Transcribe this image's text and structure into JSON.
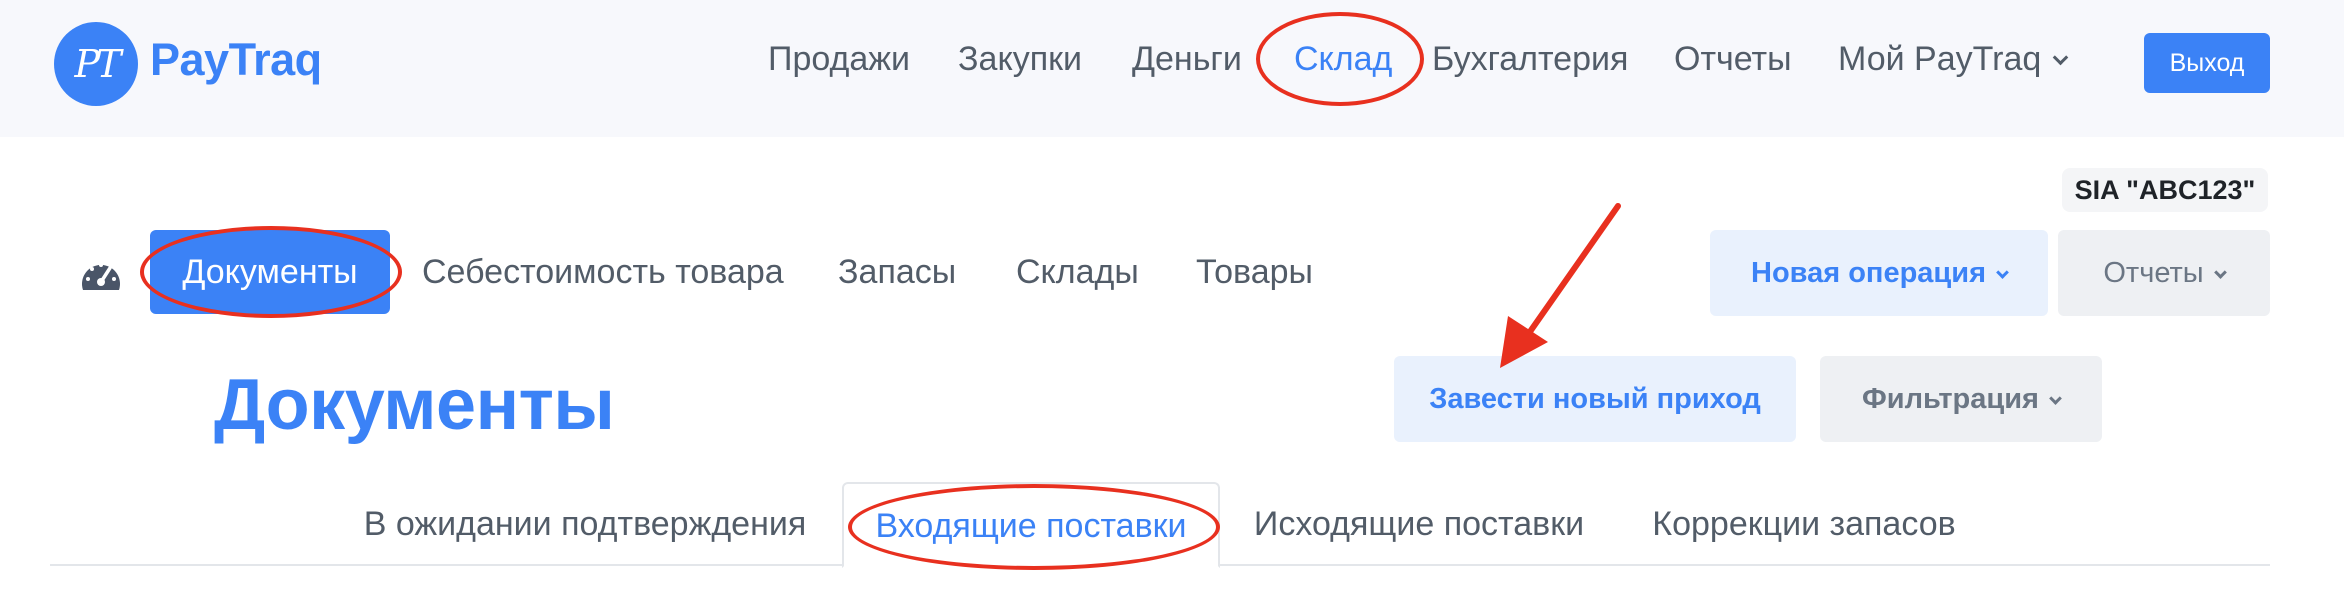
{
  "header": {
    "logo_letters": "PT",
    "brand": "PayTraq",
    "nav": [
      {
        "label": "Продажи"
      },
      {
        "label": "Закупки"
      },
      {
        "label": "Деньги"
      },
      {
        "label": "Склад",
        "active": true
      },
      {
        "label": "Бухгалтерия"
      },
      {
        "label": "Отчеты"
      },
      {
        "label": "Мой PayTraq"
      }
    ],
    "logout_label": "Выход"
  },
  "company": "SIA \"ABC123\"",
  "subnav": {
    "items": [
      {
        "label": "Документы",
        "active": true
      },
      {
        "label": "Себестоимость товара"
      },
      {
        "label": "Запасы"
      },
      {
        "label": "Склады"
      },
      {
        "label": "Товары"
      }
    ],
    "new_operation_label": "Новая операция",
    "reports_label": "Отчеты"
  },
  "page": {
    "title": "Документы",
    "new_receipt_label": "Завести новый приход",
    "filter_label": "Фильтрация"
  },
  "tabs": [
    {
      "label": "В ожидании подтверждения"
    },
    {
      "label": "Входящие поставки",
      "active": true
    },
    {
      "label": "Исходящие поставки"
    },
    {
      "label": "Коррекции запасов"
    }
  ],
  "colors": {
    "accent": "#3b82f6",
    "annotation": "#e8301f"
  },
  "icons": {
    "dashboard": "dashboard-gauge-icon",
    "dropdown": "chevron-down-icon"
  }
}
